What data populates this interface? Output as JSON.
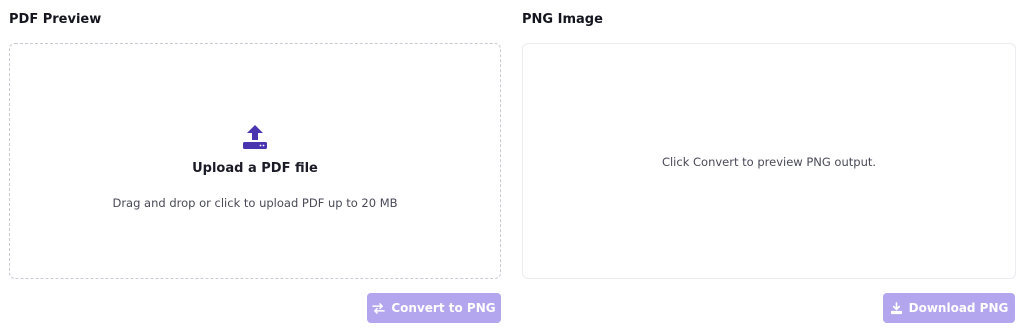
{
  "left_panel": {
    "title": "PDF Preview",
    "upload_title": "Upload a PDF file",
    "upload_hint": "Drag and drop or click to upload PDF up to 20 MB",
    "icon": "upload-icon"
  },
  "right_panel": {
    "title": "PNG Image",
    "placeholder_message": "Click Convert to preview PNG output."
  },
  "buttons": {
    "convert_label": "Convert to PNG",
    "convert_icon": "swap-arrows-icon",
    "download_label": "Download PNG",
    "download_icon": "download-icon"
  },
  "colors": {
    "accent": "#4b34b0",
    "button_bg_disabled": "#b3a6ee",
    "dropzone_border": "#c9c9d2"
  }
}
